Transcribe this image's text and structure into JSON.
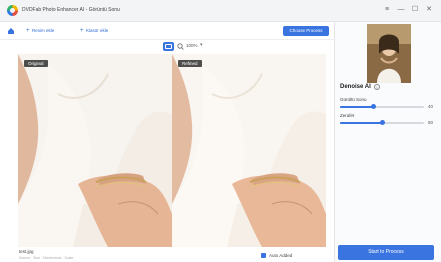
{
  "app": {
    "title": "DVDFab Photo Enhancer AI - Görüntü Sonu"
  },
  "window_controls": {
    "settings_glyph": "≡",
    "minimize_glyph": "—",
    "maximize_glyph": "☐",
    "close_glyph": "✕"
  },
  "toolbar": {
    "add_image_label": "Resim ekle",
    "add_folder_label": "Klasör ekle",
    "choose_process_label": "Choose Process"
  },
  "view": {
    "zoom": "100%",
    "zoom_chevron": "▾"
  },
  "panes": {
    "left_label": "Original",
    "right_label": "Refined"
  },
  "file": {
    "name": "test.jpg",
    "info": "Source · Size · Dimensions · Scale"
  },
  "options": {
    "auto_added_label": "Auto Added",
    "auto_added_checked": true
  },
  "sidebar": {
    "model_name": "Denoise AI",
    "info_glyph": "i",
    "params": [
      {
        "label": "Gürültü Sonu",
        "value": "40",
        "fraction": 0.4
      },
      {
        "label": "Zerafet",
        "value": "50",
        "fraction": 0.5
      }
    ],
    "start_label": "Start to Process"
  },
  "colors": {
    "accent": "#3a74e0",
    "titlebar_bg": "#f3f4f6",
    "sidebar_bg": "#fafbfc"
  }
}
